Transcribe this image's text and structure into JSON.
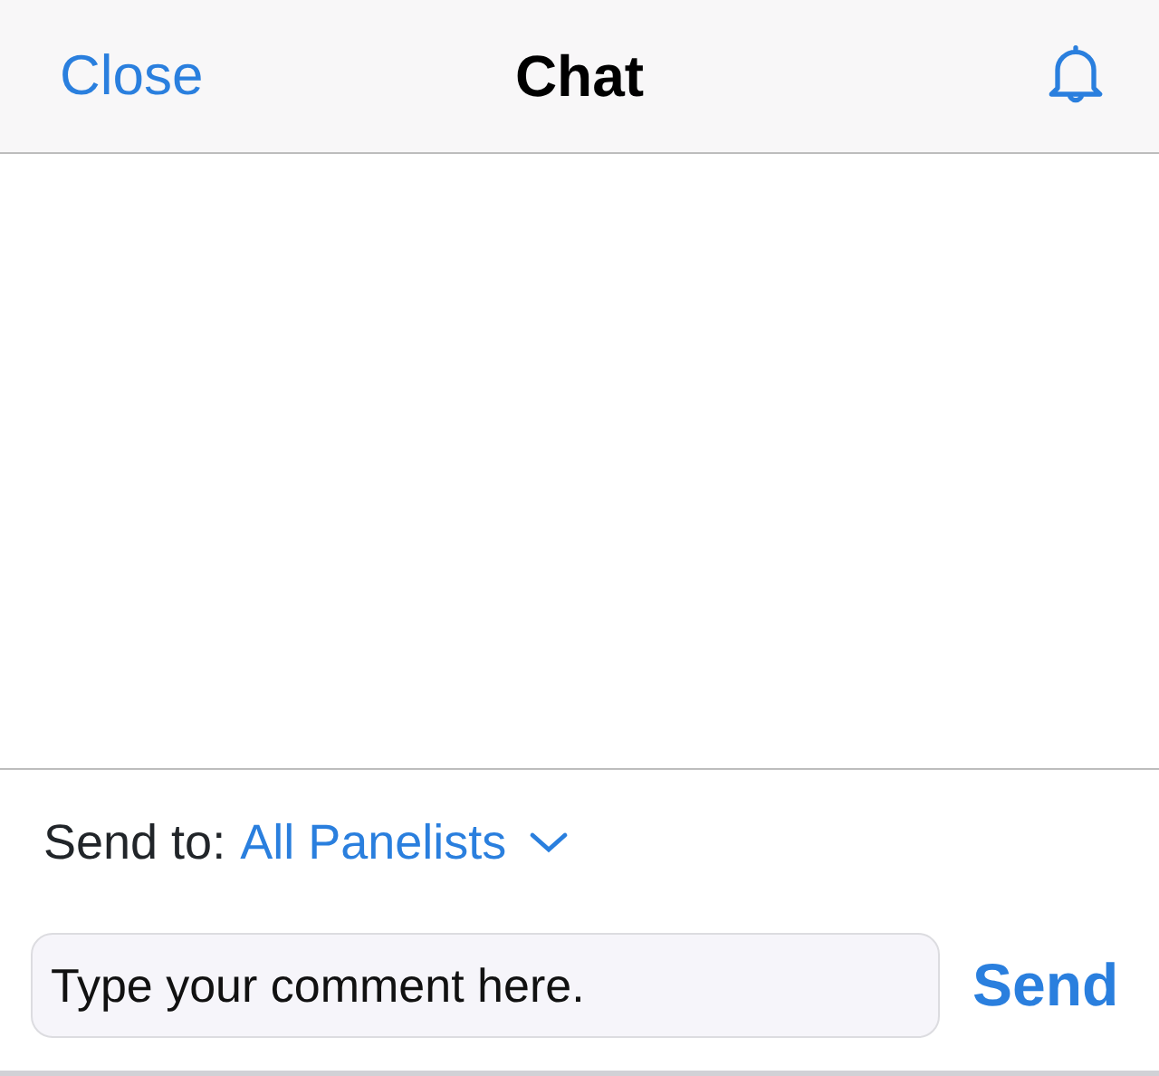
{
  "header": {
    "close": "Close",
    "title": "Chat"
  },
  "composer": {
    "send_to_label": "Send to:",
    "recipient": "All Panelists",
    "placeholder": "Type your comment here.",
    "send": "Send"
  }
}
